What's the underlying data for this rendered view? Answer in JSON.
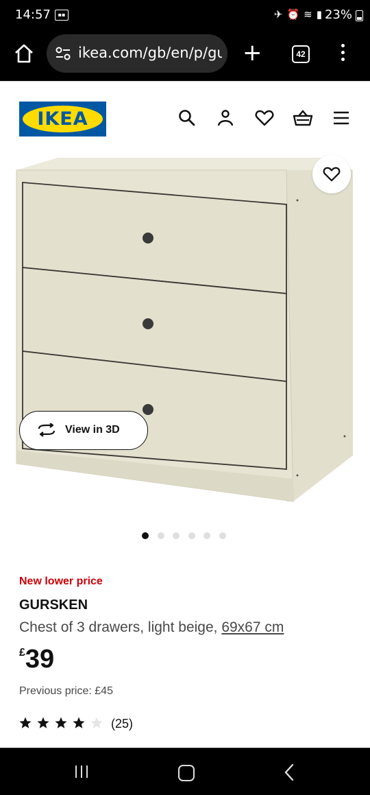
{
  "status_bar": {
    "time": "14:57",
    "battery": "23%"
  },
  "browser": {
    "url": "ikea.com/gb/en/p/gu",
    "tab_count": "42"
  },
  "site": {
    "logo_text": "IKEA",
    "brand_colors": {
      "blue": "#0058a3",
      "yellow": "#ffdb00"
    },
    "header_icons": [
      "search-icon",
      "account-icon",
      "heart-icon",
      "basket-icon",
      "menu-icon"
    ]
  },
  "product": {
    "view3d_label": "View in 3D",
    "gallery": {
      "count": 6,
      "active": 1
    },
    "badge": "New lower price",
    "badge_color": "#cc0008",
    "name": "GURSKEN",
    "desc_prefix": "Chest of 3 drawers, light beige, ",
    "desc_size": "69x67 cm",
    "currency": "£",
    "price": "39",
    "previous_price": "Previous price: £45",
    "rating": {
      "stars": 4,
      "max": 5,
      "count_label": "(25)"
    }
  }
}
